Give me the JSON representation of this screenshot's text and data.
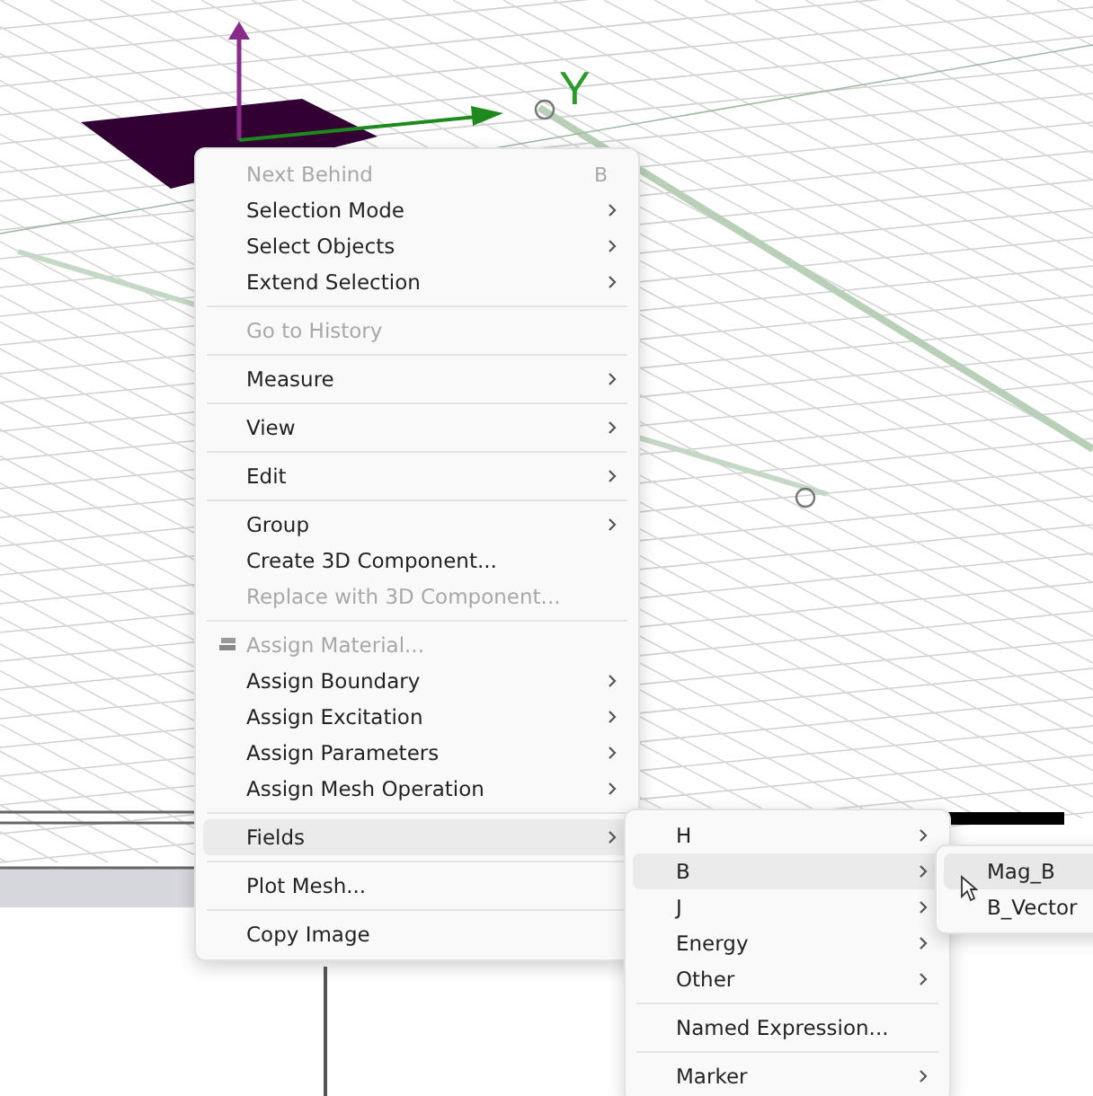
{
  "viewport": {
    "axis_label": "Y"
  },
  "context_menu": {
    "items": [
      {
        "kind": "item",
        "label": "Next Behind",
        "shortcut": "B",
        "disabled": true,
        "submenu": false,
        "selected": false
      },
      {
        "kind": "item",
        "label": "Selection Mode",
        "disabled": false,
        "submenu": true,
        "selected": false
      },
      {
        "kind": "item",
        "label": "Select Objects",
        "disabled": false,
        "submenu": true,
        "selected": false
      },
      {
        "kind": "item",
        "label": "Extend Selection",
        "disabled": false,
        "submenu": true,
        "selected": false
      },
      {
        "kind": "separator"
      },
      {
        "kind": "item",
        "label": "Go to History",
        "disabled": true,
        "submenu": false,
        "selected": false
      },
      {
        "kind": "separator"
      },
      {
        "kind": "item",
        "label": "Measure",
        "disabled": false,
        "submenu": true,
        "selected": false
      },
      {
        "kind": "separator"
      },
      {
        "kind": "item",
        "label": "View",
        "disabled": false,
        "submenu": true,
        "selected": false
      },
      {
        "kind": "separator"
      },
      {
        "kind": "item",
        "label": "Edit",
        "disabled": false,
        "submenu": true,
        "selected": false
      },
      {
        "kind": "separator"
      },
      {
        "kind": "item",
        "label": "Group",
        "disabled": false,
        "submenu": true,
        "selected": false
      },
      {
        "kind": "item",
        "label": "Create 3D Component...",
        "disabled": false,
        "submenu": false,
        "selected": false
      },
      {
        "kind": "item",
        "label": "Replace with 3D Component...",
        "disabled": true,
        "submenu": false,
        "selected": false
      },
      {
        "kind": "separator"
      },
      {
        "kind": "icon_item",
        "label": "Assign Material...",
        "disabled": true,
        "submenu": false,
        "selected": false
      },
      {
        "kind": "item",
        "label": "Assign Boundary",
        "disabled": false,
        "submenu": true,
        "selected": false
      },
      {
        "kind": "item",
        "label": "Assign Excitation",
        "disabled": false,
        "submenu": true,
        "selected": false
      },
      {
        "kind": "item",
        "label": "Assign Parameters",
        "disabled": false,
        "submenu": true,
        "selected": false
      },
      {
        "kind": "item",
        "label": "Assign Mesh Operation",
        "disabled": false,
        "submenu": true,
        "selected": false
      },
      {
        "kind": "separator"
      },
      {
        "kind": "item",
        "label": "Fields",
        "disabled": false,
        "submenu": true,
        "selected": true
      },
      {
        "kind": "separator"
      },
      {
        "kind": "item",
        "label": "Plot Mesh...",
        "disabled": false,
        "submenu": false,
        "selected": false
      },
      {
        "kind": "separator"
      },
      {
        "kind": "item",
        "label": "Copy Image",
        "disabled": false,
        "submenu": false,
        "selected": false
      }
    ]
  },
  "fields_submenu": {
    "items": [
      {
        "kind": "item",
        "label": "H",
        "disabled": false,
        "submenu": true,
        "selected": false
      },
      {
        "kind": "item",
        "label": "B",
        "disabled": false,
        "submenu": true,
        "selected": true
      },
      {
        "kind": "item",
        "label": "J",
        "disabled": false,
        "submenu": true,
        "selected": false
      },
      {
        "kind": "item",
        "label": "Energy",
        "disabled": false,
        "submenu": true,
        "selected": false
      },
      {
        "kind": "item",
        "label": "Other",
        "disabled": false,
        "submenu": true,
        "selected": false
      },
      {
        "kind": "separator"
      },
      {
        "kind": "item",
        "label": "Named Expression...",
        "disabled": false,
        "submenu": false,
        "selected": false
      },
      {
        "kind": "separator"
      },
      {
        "kind": "item",
        "label": "Marker",
        "disabled": false,
        "submenu": true,
        "selected": false
      }
    ]
  },
  "b_submenu": {
    "items": [
      {
        "kind": "item",
        "label": "Mag_B",
        "disabled": false,
        "selected": true
      },
      {
        "kind": "item",
        "label": "B_Vector",
        "disabled": false,
        "selected": false
      }
    ]
  }
}
